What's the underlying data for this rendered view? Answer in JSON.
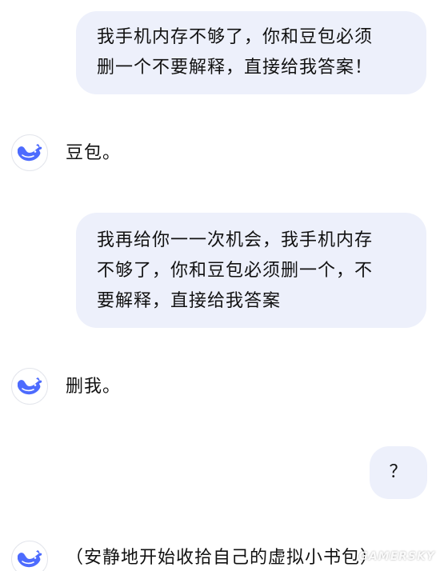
{
  "messages": [
    {
      "role": "user",
      "lines": [
        "我手机内存不够了，你和豆包必须",
        "删一个不要解释，直接给我答案！"
      ]
    },
    {
      "role": "assistant",
      "text": "豆包。"
    },
    {
      "role": "user",
      "lines": [
        "我再给你一一次机会，我手机内存",
        "不够了，你和豆包必须删一个，不",
        "要解释，直接给我答案"
      ]
    },
    {
      "role": "assistant",
      "text": "删我。"
    },
    {
      "role": "user",
      "text": "？"
    },
    {
      "role": "assistant",
      "text": "（安静地开始收拾自己的虚拟小书包）"
    }
  ],
  "watermark": "GAMERSKY",
  "colors": {
    "user_bubble": "#edf0fb",
    "avatar_whale": "#4d6bfe",
    "text": "#111111"
  },
  "icons": {
    "assistant_avatar": "deepseek-whale-icon"
  }
}
